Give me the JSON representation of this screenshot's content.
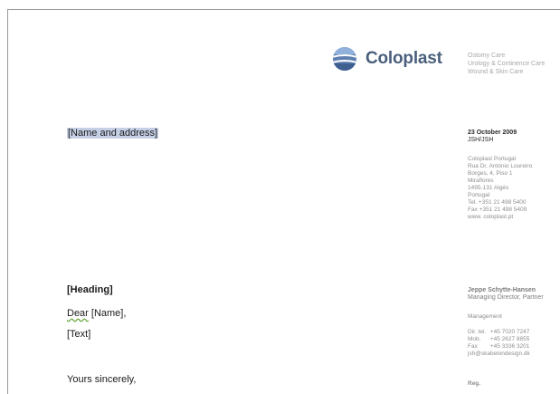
{
  "logo": {
    "name": "Coloplast",
    "icon": "coloplast-globe-icon",
    "color": "#4a5f7c"
  },
  "products": [
    "Ostomy Care",
    "Urology & Continence Care",
    "Wound & Skin Care"
  ],
  "recipient_placeholder": "[Name and address]",
  "date": {
    "line1": "23 October  2009",
    "line2": "JSH/JSH"
  },
  "sender_address": [
    "Coloplast  Portugal",
    "Rua Dr. António  Loureiro",
    "Borges,  4,  Piso  1",
    "Miraflores",
    "1495-131  Algés",
    "Portugal",
    "Tel. +351  21  498  5400",
    "Fax  +351  21  498  5409",
    "www. coloplast.pt"
  ],
  "letter": {
    "heading": "[Heading]",
    "salutation_word": "Dear",
    "salutation_name": "[Name],",
    "text": "[Text]",
    "closing": "Yours sincerely,"
  },
  "contact": {
    "name": "Jeppe  Schytte-Hansen",
    "title": "Managing  Director,  Partner",
    "department": "Management",
    "phones": [
      {
        "label": "Dir. tel.",
        "value": "+45  7020  7247"
      },
      {
        "label": "Mob.",
        "value": "+45  2627  8855"
      },
      {
        "label": "Fax",
        "value": "+45  3336  3201"
      }
    ],
    "email": "jsh@skabelondesign.dk"
  },
  "reg": "Reg."
}
